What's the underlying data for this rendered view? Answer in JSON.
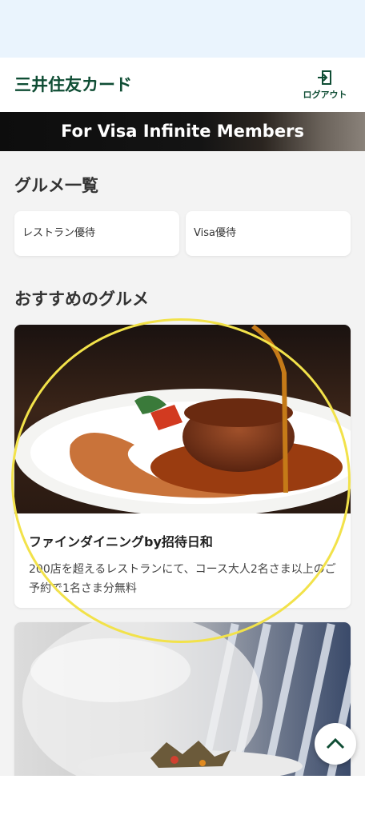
{
  "header": {
    "logo": "三井住友カード",
    "logout_label": "ログアウト",
    "logout_icon": "logout-icon"
  },
  "banner": {
    "text": "For Visa Infinite Members"
  },
  "gourmet_list": {
    "title": "グルメ一覧",
    "categories": [
      {
        "label": "レストラン優待"
      },
      {
        "label": "Visa優待"
      }
    ]
  },
  "recommended": {
    "title": "おすすめのグルメ",
    "cards": [
      {
        "title": "ファインダイニングby招待日和",
        "description": "200店を超えるレストランにて、コース大人2名さま以上のご予約で1名さま分無料"
      }
    ]
  },
  "colors": {
    "brand_green": "#0f4d34",
    "highlight": "#f2e24a"
  },
  "scroll_top_icon": "chevron-up-icon"
}
